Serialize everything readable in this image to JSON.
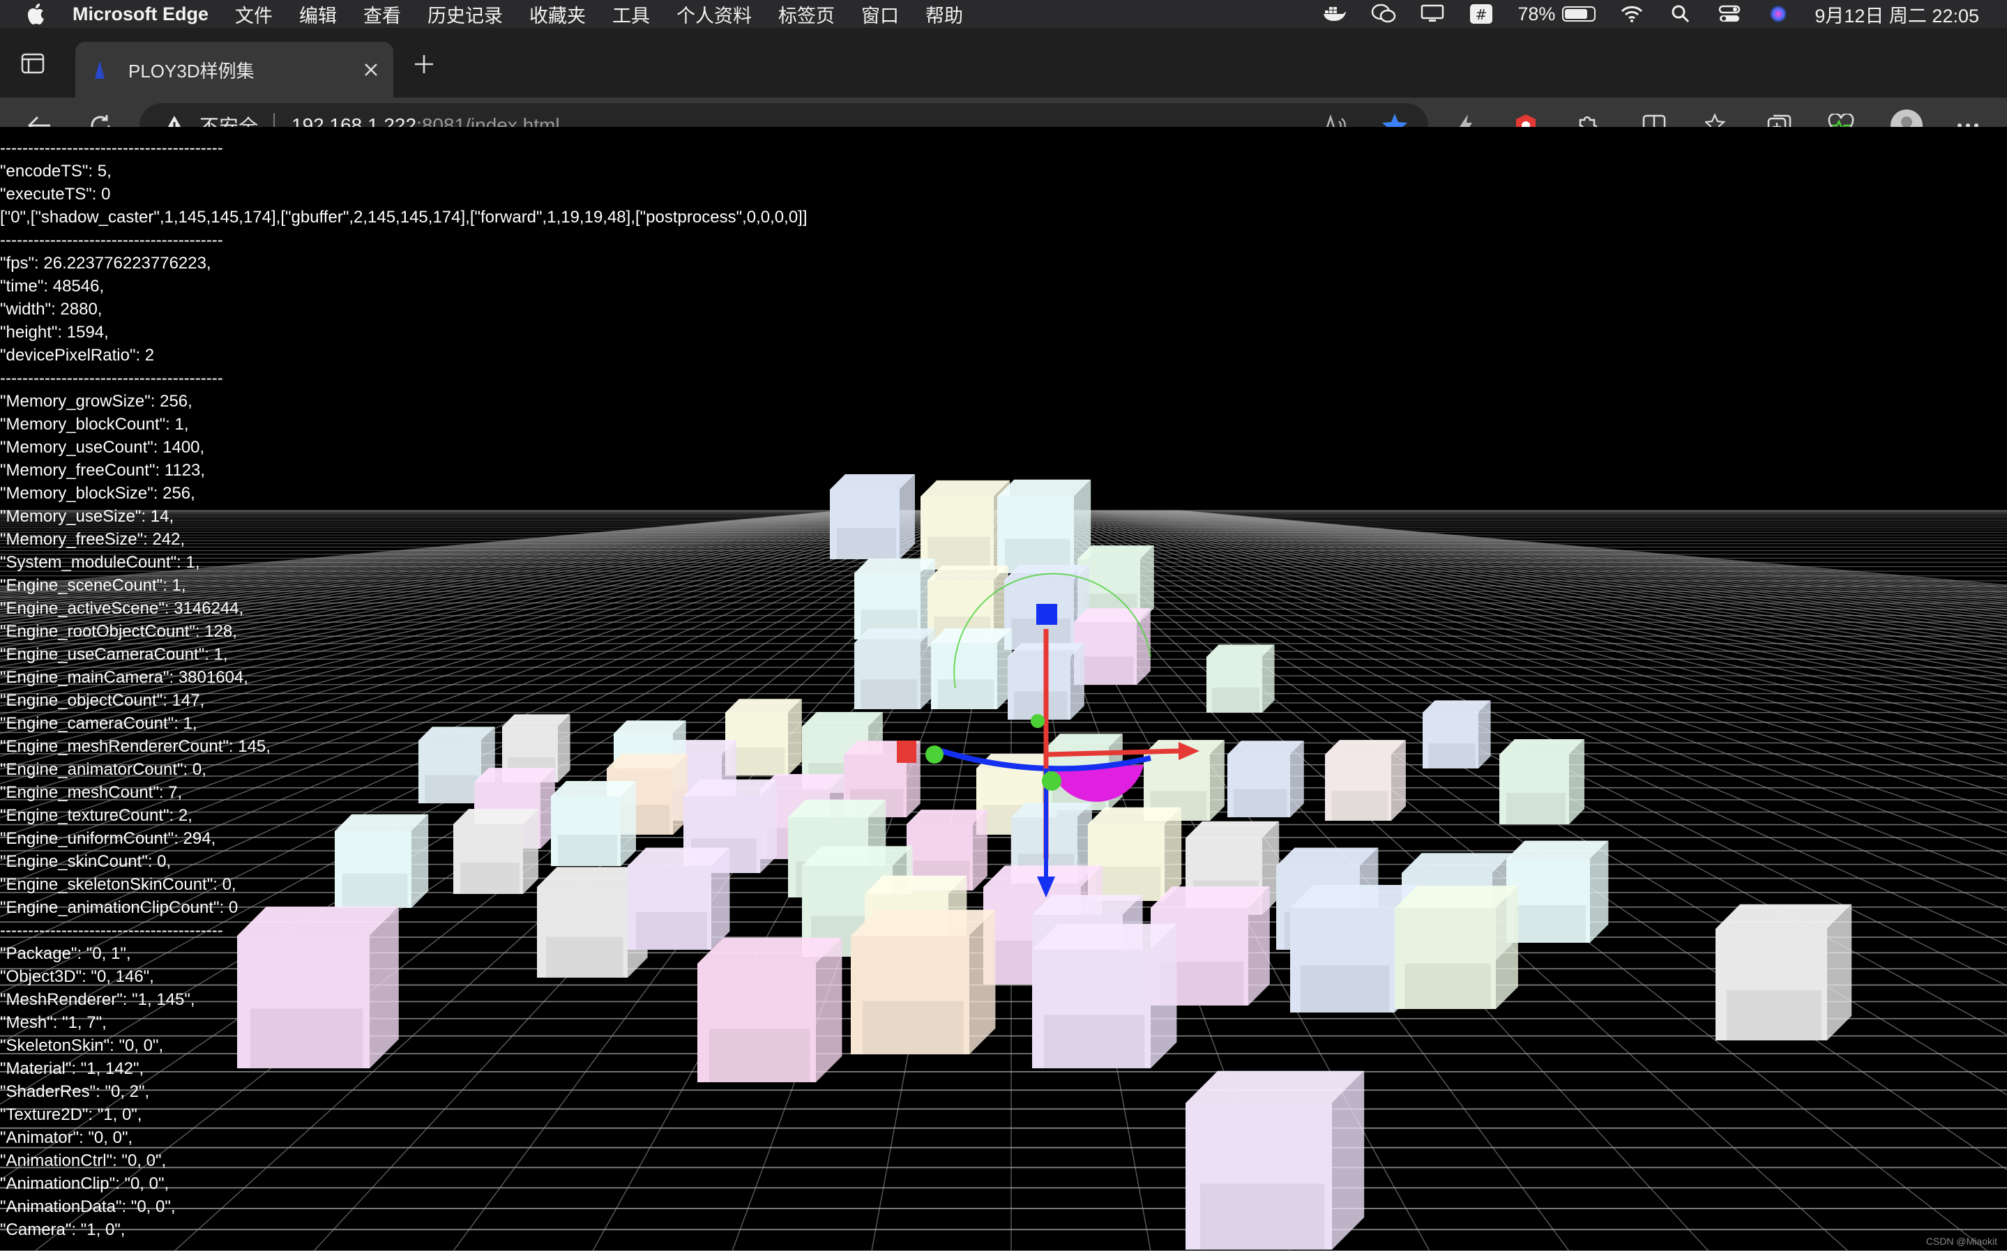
{
  "menubar": {
    "app_name": "Microsoft Edge",
    "items": [
      "文件",
      "编辑",
      "查看",
      "历史记录",
      "收藏夹",
      "工具",
      "个人资料",
      "标签页",
      "窗口",
      "帮助"
    ],
    "battery_percent": "78%",
    "battery_level": 0.78,
    "datetime": "9月12日 周二 22:05"
  },
  "tab": {
    "title": "PLOY3D样例集"
  },
  "address_bar": {
    "security_label": "不安全",
    "host": "192.168.1.222",
    "path": ":8081/index.html"
  },
  "stats": {
    "lines": [
      "----------------------------------------",
      "\"encodeTS\": 5,",
      "\"executeTS\": 0",
      "[\"0\",[\"shadow_caster\",1,145,145,174],[\"gbuffer\",2,145,145,174],[\"forward\",1,19,19,48],[\"postprocess\",0,0,0,0]]",
      "----------------------------------------",
      "\"fps\": 26.223776223776223,",
      "\"time\": 48546,",
      "\"width\": 2880,",
      "\"height\": 1594,",
      "\"devicePixelRatio\": 2",
      "----------------------------------------",
      "\"Memory_growSize\": 256,",
      "\"Memory_blockCount\": 1,",
      "\"Memory_useCount\": 1400,",
      "\"Memory_freeCount\": 1123,",
      "\"Memory_blockSize\": 256,",
      "\"Memory_useSize\": 14,",
      "\"Memory_freeSize\": 242,",
      "\"System_moduleCount\": 1,",
      "\"Engine_sceneCount\": 1,",
      "\"Engine_activeScene\": 3146244,",
      "\"Engine_rootObjectCount\": 128,",
      "\"Engine_useCameraCount\": 1,",
      "\"Engine_mainCamera\": 3801604,",
      "\"Engine_objectCount\": 147,",
      "\"Engine_cameraCount\": 1,",
      "\"Engine_meshRendererCount\": 145,",
      "\"Engine_animatorCount\": 0,",
      "\"Engine_meshCount\": 7,",
      "\"Engine_textureCount\": 2,",
      "\"Engine_uniformCount\": 294,",
      "\"Engine_skinCount\": 0,",
      "\"Engine_skeletonSkinCount\": 0,",
      "\"Engine_animationClipCount\": 0",
      "----------------------------------------",
      "\"Package\": \"0, 1\",",
      "\"Object3D\": \"0, 146\",",
      "\"MeshRenderer\": \"1, 145\",",
      "\"Mesh\": \"1, 7\",",
      "\"SkeletonSkin\": \"0, 0\",",
      "\"Material\": \"1, 142\",",
      "\"ShaderRes\": \"0, 2\",",
      "\"Texture2D\": \"1, 0\",",
      "\"Animator\": \"0, 0\",",
      "\"AnimationCtrl\": \"0, 0\",",
      "\"AnimationClip\": \"0, 0\",",
      "\"AnimationData\": \"0, 0\",",
      "\"Camera\": \"1, 0\","
    ]
  },
  "watermark": "CSDN @Miaokit",
  "colors": {
    "menubar_bg": "#2a2a2c",
    "tab_bg": "#383838",
    "favorite_star": "#3b82f6",
    "gizmo_red": "#e53935",
    "gizmo_blue": "#1430f0",
    "gizmo_green": "#4cd137",
    "gizmo_magenta": "#e020e0"
  }
}
